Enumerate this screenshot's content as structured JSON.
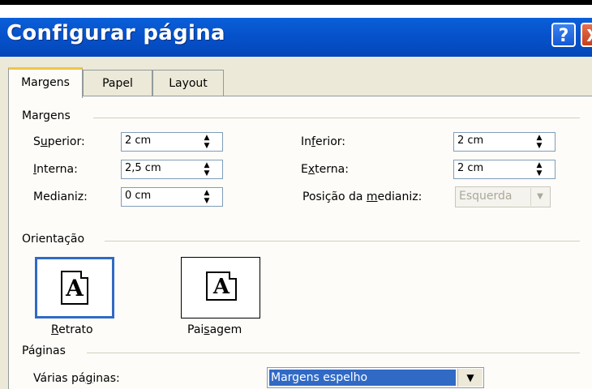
{
  "window": {
    "title": "Configurar página",
    "help_label": "?",
    "close_label": "X"
  },
  "tabs": [
    {
      "label": "Margens",
      "active": true
    },
    {
      "label": "Papel",
      "active": false
    },
    {
      "label": "Layout",
      "active": false
    }
  ],
  "margins": {
    "group_label": "Margens",
    "superior_label": "Superior:",
    "superior_value": "2 cm",
    "inferior_label": "Inferior:",
    "inferior_value": "2 cm",
    "interna_label": "Interna:",
    "interna_value": "2,5 cm",
    "externa_label": "Externa:",
    "externa_value": "2 cm",
    "medianiz_label": "Medianiz:",
    "medianiz_value": "0 cm",
    "posicao_label": "Posição da medianiz:",
    "posicao_value": "Esquerda"
  },
  "orientation": {
    "group_label": "Orientação",
    "portrait_label": "Retrato",
    "landscape_label": "Paisagem",
    "glyph": "A",
    "selected": "Retrato"
  },
  "pages": {
    "group_label": "Páginas",
    "multiple_label": "Várias páginas:",
    "multiple_value": "Margens espelho"
  },
  "colors": {
    "title_bar": "#0652cc",
    "selection": "#316ac5",
    "dialog_bg": "#ECE9D8"
  }
}
